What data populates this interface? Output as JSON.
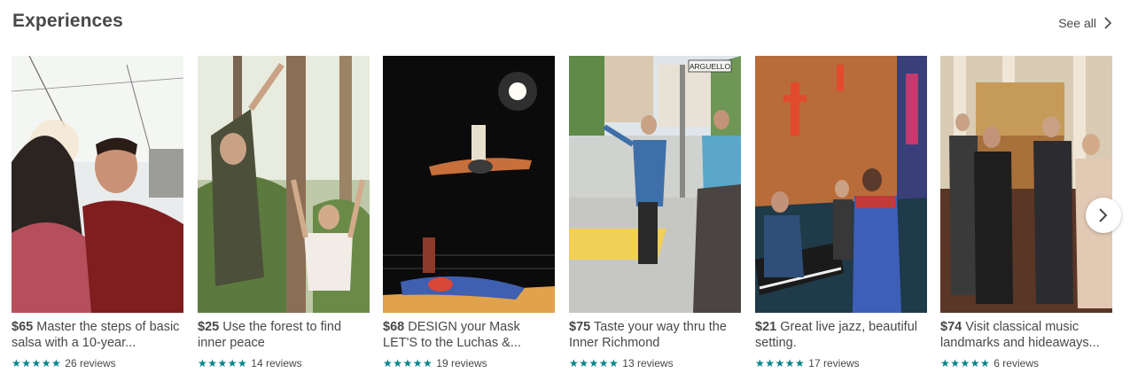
{
  "section": {
    "title": "Experiences",
    "see_all_label": "See all"
  },
  "colors": {
    "star": "#008489",
    "text": "#484848"
  },
  "icons": {
    "see_all": "chevron-right-icon",
    "next": "chevron-right-icon",
    "star": "star-icon"
  },
  "experiences": [
    {
      "price": "$65",
      "title": "Master the steps of basic salsa with a 10-year...",
      "stars": "★★★★★",
      "reviews": "26 reviews",
      "rating_stars": 5
    },
    {
      "price": "$25",
      "title": "Use the forest to find inner peace",
      "stars": "★★★★★",
      "reviews": "14 reviews",
      "rating_stars": 5
    },
    {
      "price": "$68",
      "title": "DESIGN your Mask LET'S to the Luchas &...",
      "stars": "★★★★★",
      "reviews": "19 reviews",
      "rating_stars": 5
    },
    {
      "price": "$75",
      "title": "Taste your way thru the Inner Richmond",
      "stars": "★★★★★",
      "reviews": "13 reviews",
      "rating_stars": 5
    },
    {
      "price": "$21",
      "title": "Great live jazz, beautiful setting.",
      "stars": "★★★★★",
      "reviews": "17 reviews",
      "rating_stars": 5
    },
    {
      "price": "$74",
      "title": "Visit classical music landmarks and hideaways...",
      "stars": "★★★★★",
      "reviews": "6 reviews",
      "rating_stars": 5
    }
  ],
  "photos": {
    "street_sign": "ARGUELLO"
  }
}
